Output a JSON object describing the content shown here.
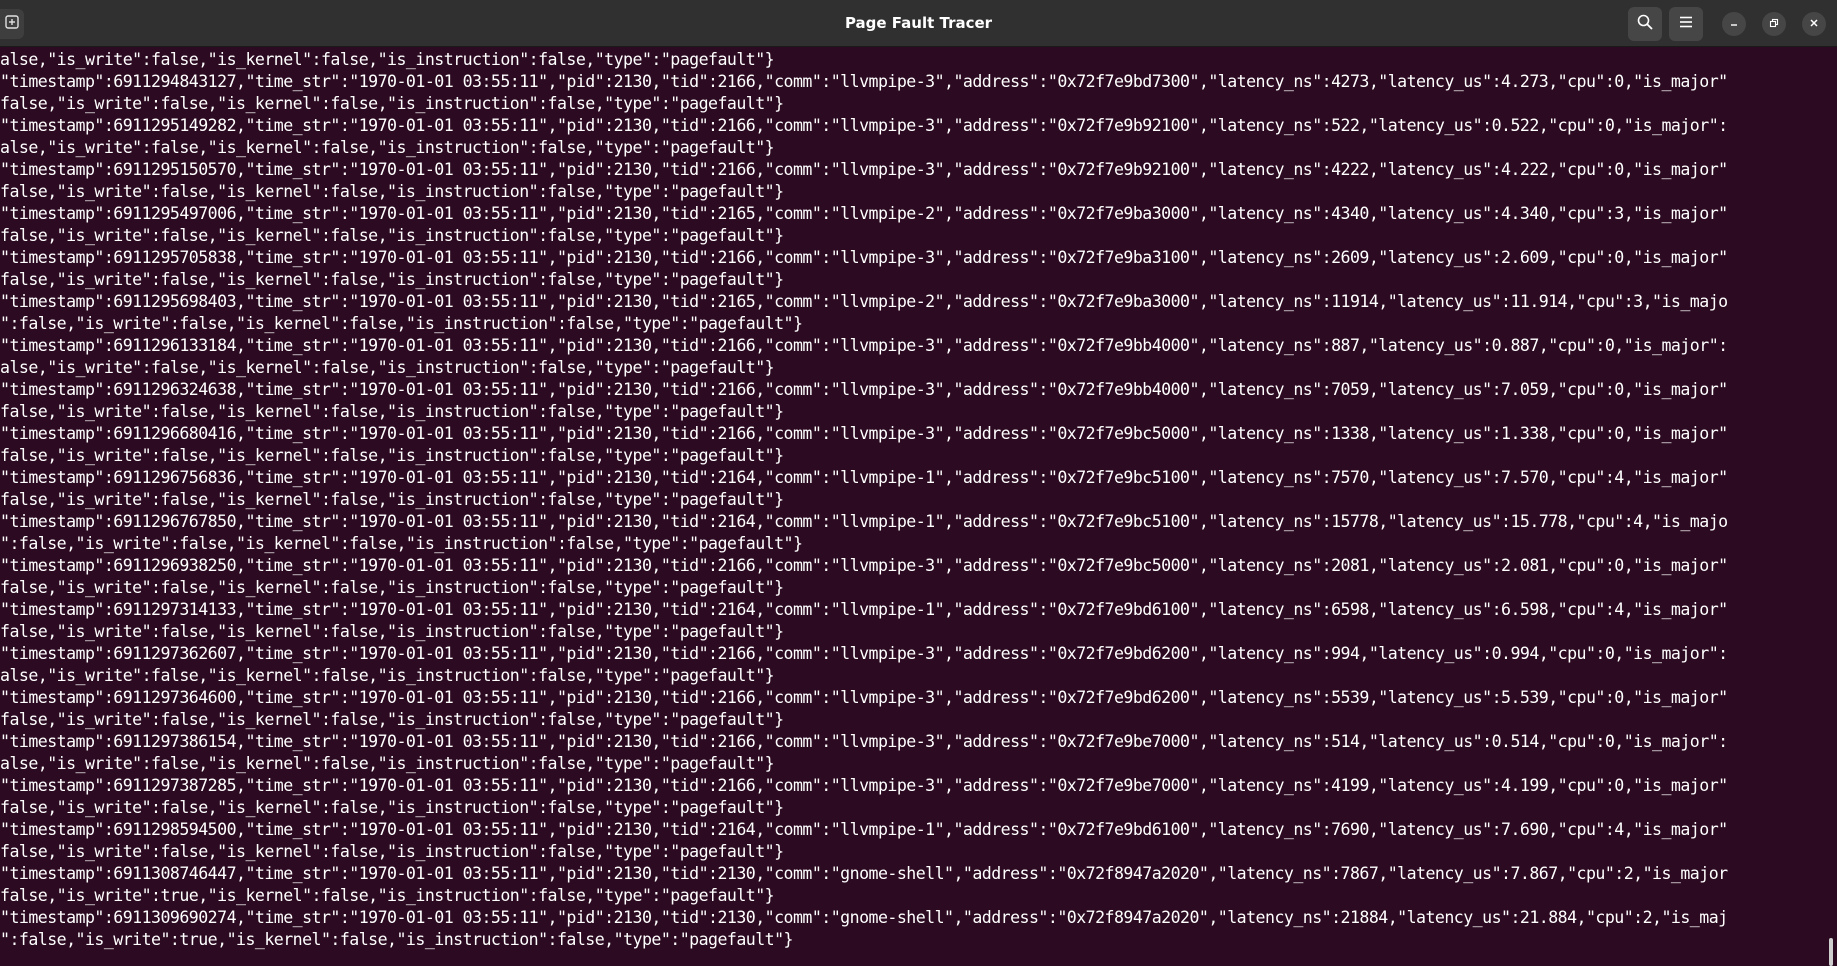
{
  "window": {
    "title": "Page Fault Tracer"
  },
  "icons": {
    "new_tab": "new-tab-icon",
    "search": "search-icon",
    "menu": "hamburger-menu-icon",
    "minimize": "minimize-icon",
    "maximize": "maximize-icon",
    "close": "close-icon"
  },
  "terminal": {
    "lines": [
      "alse,\"is_write\":false,\"is_kernel\":false,\"is_instruction\":false,\"type\":\"pagefault\"}",
      "\"timestamp\":6911294843127,\"time_str\":\"1970-01-01 03:55:11\",\"pid\":2130,\"tid\":2166,\"comm\":\"llvmpipe-3\",\"address\":\"0x72f7e9bd7300\",\"latency_ns\":4273,\"latency_us\":4.273,\"cpu\":0,\"is_major\"",
      "false,\"is_write\":false,\"is_kernel\":false,\"is_instruction\":false,\"type\":\"pagefault\"}",
      "\"timestamp\":6911295149282,\"time_str\":\"1970-01-01 03:55:11\",\"pid\":2130,\"tid\":2166,\"comm\":\"llvmpipe-3\",\"address\":\"0x72f7e9b92100\",\"latency_ns\":522,\"latency_us\":0.522,\"cpu\":0,\"is_major\":",
      "alse,\"is_write\":false,\"is_kernel\":false,\"is_instruction\":false,\"type\":\"pagefault\"}",
      "\"timestamp\":6911295150570,\"time_str\":\"1970-01-01 03:55:11\",\"pid\":2130,\"tid\":2166,\"comm\":\"llvmpipe-3\",\"address\":\"0x72f7e9b92100\",\"latency_ns\":4222,\"latency_us\":4.222,\"cpu\":0,\"is_major\"",
      "false,\"is_write\":false,\"is_kernel\":false,\"is_instruction\":false,\"type\":\"pagefault\"}",
      "\"timestamp\":6911295497006,\"time_str\":\"1970-01-01 03:55:11\",\"pid\":2130,\"tid\":2165,\"comm\":\"llvmpipe-2\",\"address\":\"0x72f7e9ba3000\",\"latency_ns\":4340,\"latency_us\":4.340,\"cpu\":3,\"is_major\"",
      "false,\"is_write\":false,\"is_kernel\":false,\"is_instruction\":false,\"type\":\"pagefault\"}",
      "\"timestamp\":6911295705838,\"time_str\":\"1970-01-01 03:55:11\",\"pid\":2130,\"tid\":2166,\"comm\":\"llvmpipe-3\",\"address\":\"0x72f7e9ba3100\",\"latency_ns\":2609,\"latency_us\":2.609,\"cpu\":0,\"is_major\"",
      "false,\"is_write\":false,\"is_kernel\":false,\"is_instruction\":false,\"type\":\"pagefault\"}",
      "\"timestamp\":6911295698403,\"time_str\":\"1970-01-01 03:55:11\",\"pid\":2130,\"tid\":2165,\"comm\":\"llvmpipe-2\",\"address\":\"0x72f7e9ba3000\",\"latency_ns\":11914,\"latency_us\":11.914,\"cpu\":3,\"is_majo",
      "\":false,\"is_write\":false,\"is_kernel\":false,\"is_instruction\":false,\"type\":\"pagefault\"}",
      "\"timestamp\":6911296133184,\"time_str\":\"1970-01-01 03:55:11\",\"pid\":2130,\"tid\":2166,\"comm\":\"llvmpipe-3\",\"address\":\"0x72f7e9bb4000\",\"latency_ns\":887,\"latency_us\":0.887,\"cpu\":0,\"is_major\":",
      "alse,\"is_write\":false,\"is_kernel\":false,\"is_instruction\":false,\"type\":\"pagefault\"}",
      "\"timestamp\":6911296324638,\"time_str\":\"1970-01-01 03:55:11\",\"pid\":2130,\"tid\":2166,\"comm\":\"llvmpipe-3\",\"address\":\"0x72f7e9bb4000\",\"latency_ns\":7059,\"latency_us\":7.059,\"cpu\":0,\"is_major\"",
      "false,\"is_write\":false,\"is_kernel\":false,\"is_instruction\":false,\"type\":\"pagefault\"}",
      "\"timestamp\":6911296680416,\"time_str\":\"1970-01-01 03:55:11\",\"pid\":2130,\"tid\":2166,\"comm\":\"llvmpipe-3\",\"address\":\"0x72f7e9bc5000\",\"latency_ns\":1338,\"latency_us\":1.338,\"cpu\":0,\"is_major\"",
      "false,\"is_write\":false,\"is_kernel\":false,\"is_instruction\":false,\"type\":\"pagefault\"}",
      "\"timestamp\":6911296756836,\"time_str\":\"1970-01-01 03:55:11\",\"pid\":2130,\"tid\":2164,\"comm\":\"llvmpipe-1\",\"address\":\"0x72f7e9bc5100\",\"latency_ns\":7570,\"latency_us\":7.570,\"cpu\":4,\"is_major\"",
      "false,\"is_write\":false,\"is_kernel\":false,\"is_instruction\":false,\"type\":\"pagefault\"}",
      "\"timestamp\":6911296767850,\"time_str\":\"1970-01-01 03:55:11\",\"pid\":2130,\"tid\":2164,\"comm\":\"llvmpipe-1\",\"address\":\"0x72f7e9bc5100\",\"latency_ns\":15778,\"latency_us\":15.778,\"cpu\":4,\"is_majo",
      "\":false,\"is_write\":false,\"is_kernel\":false,\"is_instruction\":false,\"type\":\"pagefault\"}",
      "\"timestamp\":6911296938250,\"time_str\":\"1970-01-01 03:55:11\",\"pid\":2130,\"tid\":2166,\"comm\":\"llvmpipe-3\",\"address\":\"0x72f7e9bc5000\",\"latency_ns\":2081,\"latency_us\":2.081,\"cpu\":0,\"is_major\"",
      "false,\"is_write\":false,\"is_kernel\":false,\"is_instruction\":false,\"type\":\"pagefault\"}",
      "\"timestamp\":6911297314133,\"time_str\":\"1970-01-01 03:55:11\",\"pid\":2130,\"tid\":2164,\"comm\":\"llvmpipe-1\",\"address\":\"0x72f7e9bd6100\",\"latency_ns\":6598,\"latency_us\":6.598,\"cpu\":4,\"is_major\"",
      "false,\"is_write\":false,\"is_kernel\":false,\"is_instruction\":false,\"type\":\"pagefault\"}",
      "\"timestamp\":6911297362607,\"time_str\":\"1970-01-01 03:55:11\",\"pid\":2130,\"tid\":2166,\"comm\":\"llvmpipe-3\",\"address\":\"0x72f7e9bd6200\",\"latency_ns\":994,\"latency_us\":0.994,\"cpu\":0,\"is_major\":",
      "alse,\"is_write\":false,\"is_kernel\":false,\"is_instruction\":false,\"type\":\"pagefault\"}",
      "\"timestamp\":6911297364600,\"time_str\":\"1970-01-01 03:55:11\",\"pid\":2130,\"tid\":2166,\"comm\":\"llvmpipe-3\",\"address\":\"0x72f7e9bd6200\",\"latency_ns\":5539,\"latency_us\":5.539,\"cpu\":0,\"is_major\"",
      "false,\"is_write\":false,\"is_kernel\":false,\"is_instruction\":false,\"type\":\"pagefault\"}",
      "\"timestamp\":6911297386154,\"time_str\":\"1970-01-01 03:55:11\",\"pid\":2130,\"tid\":2166,\"comm\":\"llvmpipe-3\",\"address\":\"0x72f7e9be7000\",\"latency_ns\":514,\"latency_us\":0.514,\"cpu\":0,\"is_major\":",
      "alse,\"is_write\":false,\"is_kernel\":false,\"is_instruction\":false,\"type\":\"pagefault\"}",
      "\"timestamp\":6911297387285,\"time_str\":\"1970-01-01 03:55:11\",\"pid\":2130,\"tid\":2166,\"comm\":\"llvmpipe-3\",\"address\":\"0x72f7e9be7000\",\"latency_ns\":4199,\"latency_us\":4.199,\"cpu\":0,\"is_major\"",
      "false,\"is_write\":false,\"is_kernel\":false,\"is_instruction\":false,\"type\":\"pagefault\"}",
      "\"timestamp\":6911298594500,\"time_str\":\"1970-01-01 03:55:11\",\"pid\":2130,\"tid\":2164,\"comm\":\"llvmpipe-1\",\"address\":\"0x72f7e9bd6100\",\"latency_ns\":7690,\"latency_us\":7.690,\"cpu\":4,\"is_major\"",
      "false,\"is_write\":false,\"is_kernel\":false,\"is_instruction\":false,\"type\":\"pagefault\"}",
      "\"timestamp\":6911308746447,\"time_str\":\"1970-01-01 03:55:11\",\"pid\":2130,\"tid\":2130,\"comm\":\"gnome-shell\",\"address\":\"0x72f8947a2020\",\"latency_ns\":7867,\"latency_us\":7.867,\"cpu\":2,\"is_major",
      "false,\"is_write\":true,\"is_kernel\":false,\"is_instruction\":false,\"type\":\"pagefault\"}",
      "\"timestamp\":6911309690274,\"time_str\":\"1970-01-01 03:55:11\",\"pid\":2130,\"tid\":2130,\"comm\":\"gnome-shell\",\"address\":\"0x72f8947a2020\",\"latency_ns\":21884,\"latency_us\":21.884,\"cpu\":2,\"is_maj",
      "\":false,\"is_write\":true,\"is_kernel\":false,\"is_instruction\":false,\"type\":\"pagefault\"}"
    ]
  },
  "colors": {
    "terminal_bg": "#2c0a21",
    "titlebar_bg": "#303030",
    "text": "#ffffff"
  }
}
